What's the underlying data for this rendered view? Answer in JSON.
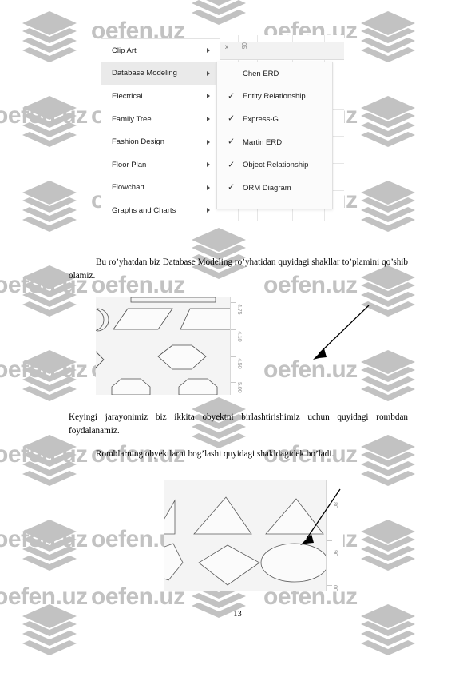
{
  "document": {
    "page_number": "13"
  },
  "watermark": {
    "text": "oefen.uz",
    "logo_icon": "stacked-layers-icon",
    "color": "#c2c2c2"
  },
  "menu_screenshot": {
    "app_hint": "visio-shapes-menu",
    "sheet": {
      "close_mark": "x",
      "column_label": "05"
    },
    "main_menu": {
      "items": [
        {
          "label": "Clip Art",
          "has_submenu": true,
          "selected": false
        },
        {
          "label": "Database Modeling",
          "has_submenu": true,
          "selected": true
        },
        {
          "label": "Electrical",
          "has_submenu": true,
          "selected": false
        },
        {
          "label": "Family Tree",
          "has_submenu": true,
          "selected": false
        },
        {
          "label": "Fashion Design",
          "has_submenu": true,
          "selected": false
        },
        {
          "label": "Floor Plan",
          "has_submenu": true,
          "selected": false
        },
        {
          "label": "Flowchart",
          "has_submenu": true,
          "selected": false
        },
        {
          "label": "Graphs and Charts",
          "has_submenu": true,
          "selected": false
        }
      ]
    },
    "submenu": {
      "items": [
        {
          "label": "Chen ERD",
          "checked": false
        },
        {
          "label": "Entity Relationship",
          "checked": true
        },
        {
          "label": "Express-G",
          "checked": true
        },
        {
          "label": "Martin ERD",
          "checked": true
        },
        {
          "label": "Object Relationship",
          "checked": true
        },
        {
          "label": "ORM Diagram",
          "checked": true
        }
      ],
      "check_glyph": "✓"
    }
  },
  "paragraphs": {
    "p1": "Bu ro’yhatdan biz Database Modeling ro’yhatidan quyidagi shakllar to’plamini qo’shib olamiz.",
    "p2": "Keyingi jarayonimiz biz ikkita obyektni birlashtirishimiz uchun quyidagi rombdan foydalanamiz.",
    "p3": "Romblarning obyektlarni bog’lashi quyidagi shakldagidek bo’ladi."
  },
  "figure_shapes_top": {
    "name": "database-modeling-shapes-figure",
    "ruler_labels": [
      "4.75",
      "4.10",
      "4.50",
      "5.00"
    ]
  },
  "figure_shapes_bottom": {
    "name": "romb-shapes-figure",
    "ruler_labels": [
      "80",
      "90",
      "00"
    ]
  }
}
